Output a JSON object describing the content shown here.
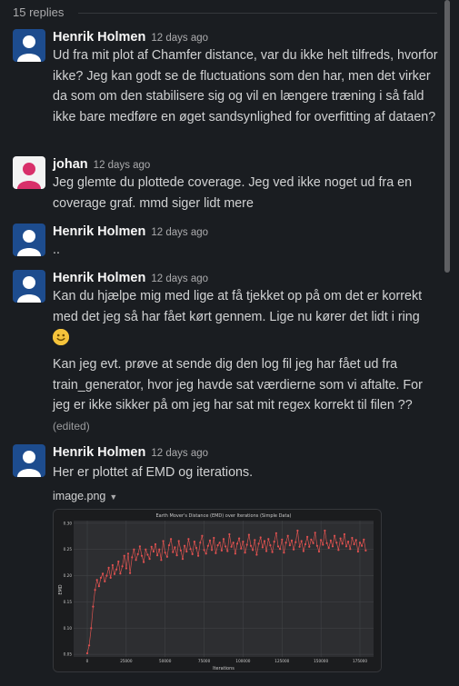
{
  "thread": {
    "replies_label": "15 replies"
  },
  "messages": [
    {
      "author": "Henrik Holmen",
      "time": "12 days ago",
      "avatar_color": "#1d4c8e",
      "paragraphs": [
        "Ud fra mit plot af Chamfer distance, var du ikke helt tilfreds, hvorfor ikke? Jeg kan godt se de fluctuations som den har, men det virker da som om den stabilisere sig og vil en længere træning i så fald ikke bare medføre en øget sandsynlighed for overfitting af dataen?"
      ]
    },
    {
      "author": "johan",
      "time": "12 days ago",
      "avatar_color": "#d8306a",
      "paragraphs": [
        "Jeg glemte du plottede coverage. Jeg ved ikke noget ud fra en coverage graf. mmd siger lidt mere"
      ]
    },
    {
      "author": "Henrik Holmen",
      "time": "12 days ago",
      "avatar_color": "#1d4c8e",
      "paragraphs": [
        ".."
      ]
    },
    {
      "author": "Henrik Holmen",
      "time": "12 days ago",
      "avatar_color": "#1d4c8e",
      "paragraphs": [
        "Kan du hjælpe mig med lige at få tjekket op på om det er korrekt med det jeg så har fået kørt gennem. Lige nu kører det lidt i ring",
        "Kan jeg evt. prøve at sende dig den log fil jeg har fået ud fra train_generator, hvor jeg havde sat værdierne som vi aftalte. For jeg er ikke sikker på om jeg har sat mit regex korrekt til filen ??"
      ],
      "emoji": "slightly-smiling-face",
      "edited_label": "(edited)"
    },
    {
      "author": "Henrik Holmen",
      "time": "12 days ago",
      "avatar_color": "#1d4c8e",
      "paragraphs": [
        "Her er plottet af EMD og iterations."
      ],
      "attachment": {
        "filename": "image.png",
        "caret_icon": "chevron-down-icon"
      }
    }
  ],
  "chart_data": {
    "type": "line",
    "title": "Earth Mover's Distance (EMD) over Iterations (Simple Data)",
    "xlabel": "Iterations",
    "ylabel": "EMD",
    "xlim": [
      -8750,
      183750
    ],
    "ylim": [
      0.045,
      0.305
    ],
    "x_ticks": [
      0,
      25000,
      50000,
      75000,
      100000,
      125000,
      150000,
      175000
    ],
    "x_tick_labels": [
      "0",
      "25000",
      "50000",
      "75000",
      "100000",
      "125000",
      "150000",
      "175000"
    ],
    "y_ticks": [
      0.05,
      0.1,
      0.15,
      0.2,
      0.25,
      0.3
    ],
    "y_tick_labels": [
      "0.05",
      "0.10",
      "0.15",
      "0.20",
      "0.25",
      "0.30"
    ],
    "grid": true,
    "line_color": "#d9534f",
    "marker_color": "#e05050",
    "series": [
      {
        "x_start": 0,
        "x_step": 1250,
        "values": [
          0.052,
          0.067,
          0.1,
          0.141,
          0.173,
          0.192,
          0.18,
          0.196,
          0.204,
          0.189,
          0.2,
          0.215,
          0.196,
          0.22,
          0.203,
          0.212,
          0.227,
          0.204,
          0.218,
          0.238,
          0.214,
          0.242,
          0.205,
          0.235,
          0.25,
          0.23,
          0.241,
          0.256,
          0.238,
          0.226,
          0.25,
          0.24,
          0.232,
          0.255,
          0.246,
          0.26,
          0.239,
          0.25,
          0.23,
          0.266,
          0.244,
          0.236,
          0.258,
          0.27,
          0.245,
          0.254,
          0.239,
          0.266,
          0.248,
          0.232,
          0.257,
          0.246,
          0.27,
          0.251,
          0.241,
          0.265,
          0.253,
          0.238,
          0.263,
          0.276,
          0.249,
          0.242,
          0.257,
          0.267,
          0.249,
          0.272,
          0.243,
          0.258,
          0.263,
          0.248,
          0.27,
          0.256,
          0.247,
          0.279,
          0.255,
          0.263,
          0.242,
          0.261,
          0.271,
          0.252,
          0.265,
          0.244,
          0.259,
          0.278,
          0.257,
          0.249,
          0.268,
          0.24,
          0.261,
          0.273,
          0.254,
          0.266,
          0.247,
          0.27,
          0.258,
          0.245,
          0.265,
          0.281,
          0.256,
          0.251,
          0.269,
          0.244,
          0.263,
          0.276,
          0.258,
          0.267,
          0.25,
          0.264,
          0.286,
          0.255,
          0.266,
          0.247,
          0.26,
          0.274,
          0.255,
          0.269,
          0.262,
          0.282,
          0.257,
          0.246,
          0.268,
          0.259,
          0.286,
          0.262,
          0.253,
          0.267,
          0.256,
          0.276,
          0.263,
          0.249,
          0.271,
          0.261,
          0.279,
          0.256,
          0.265,
          0.251,
          0.272,
          0.26,
          0.268,
          0.246,
          0.263,
          0.257,
          0.269,
          0.248
        ]
      }
    ]
  }
}
